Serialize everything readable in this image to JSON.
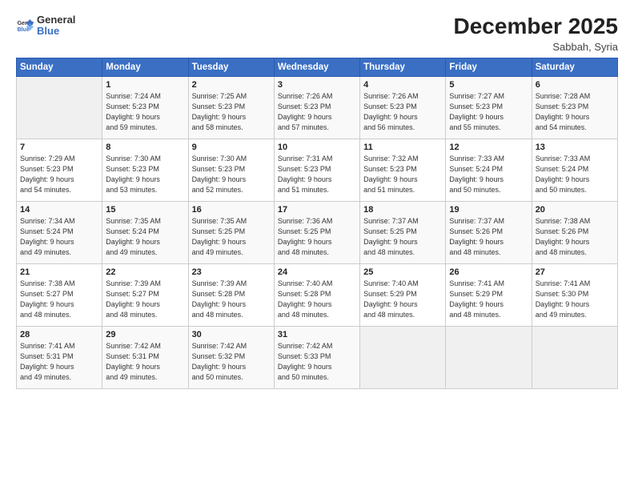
{
  "logo": {
    "general": "General",
    "blue": "Blue"
  },
  "title": "December 2025",
  "subtitle": "Sabbah, Syria",
  "days_header": [
    "Sunday",
    "Monday",
    "Tuesday",
    "Wednesday",
    "Thursday",
    "Friday",
    "Saturday"
  ],
  "weeks": [
    [
      {
        "day": "",
        "info": ""
      },
      {
        "day": "1",
        "info": "Sunrise: 7:24 AM\nSunset: 5:23 PM\nDaylight: 9 hours\nand 59 minutes."
      },
      {
        "day": "2",
        "info": "Sunrise: 7:25 AM\nSunset: 5:23 PM\nDaylight: 9 hours\nand 58 minutes."
      },
      {
        "day": "3",
        "info": "Sunrise: 7:26 AM\nSunset: 5:23 PM\nDaylight: 9 hours\nand 57 minutes."
      },
      {
        "day": "4",
        "info": "Sunrise: 7:26 AM\nSunset: 5:23 PM\nDaylight: 9 hours\nand 56 minutes."
      },
      {
        "day": "5",
        "info": "Sunrise: 7:27 AM\nSunset: 5:23 PM\nDaylight: 9 hours\nand 55 minutes."
      },
      {
        "day": "6",
        "info": "Sunrise: 7:28 AM\nSunset: 5:23 PM\nDaylight: 9 hours\nand 54 minutes."
      }
    ],
    [
      {
        "day": "7",
        "info": "Sunrise: 7:29 AM\nSunset: 5:23 PM\nDaylight: 9 hours\nand 54 minutes."
      },
      {
        "day": "8",
        "info": "Sunrise: 7:30 AM\nSunset: 5:23 PM\nDaylight: 9 hours\nand 53 minutes."
      },
      {
        "day": "9",
        "info": "Sunrise: 7:30 AM\nSunset: 5:23 PM\nDaylight: 9 hours\nand 52 minutes."
      },
      {
        "day": "10",
        "info": "Sunrise: 7:31 AM\nSunset: 5:23 PM\nDaylight: 9 hours\nand 51 minutes."
      },
      {
        "day": "11",
        "info": "Sunrise: 7:32 AM\nSunset: 5:23 PM\nDaylight: 9 hours\nand 51 minutes."
      },
      {
        "day": "12",
        "info": "Sunrise: 7:33 AM\nSunset: 5:24 PM\nDaylight: 9 hours\nand 50 minutes."
      },
      {
        "day": "13",
        "info": "Sunrise: 7:33 AM\nSunset: 5:24 PM\nDaylight: 9 hours\nand 50 minutes."
      }
    ],
    [
      {
        "day": "14",
        "info": "Sunrise: 7:34 AM\nSunset: 5:24 PM\nDaylight: 9 hours\nand 49 minutes."
      },
      {
        "day": "15",
        "info": "Sunrise: 7:35 AM\nSunset: 5:24 PM\nDaylight: 9 hours\nand 49 minutes."
      },
      {
        "day": "16",
        "info": "Sunrise: 7:35 AM\nSunset: 5:25 PM\nDaylight: 9 hours\nand 49 minutes."
      },
      {
        "day": "17",
        "info": "Sunrise: 7:36 AM\nSunset: 5:25 PM\nDaylight: 9 hours\nand 48 minutes."
      },
      {
        "day": "18",
        "info": "Sunrise: 7:37 AM\nSunset: 5:25 PM\nDaylight: 9 hours\nand 48 minutes."
      },
      {
        "day": "19",
        "info": "Sunrise: 7:37 AM\nSunset: 5:26 PM\nDaylight: 9 hours\nand 48 minutes."
      },
      {
        "day": "20",
        "info": "Sunrise: 7:38 AM\nSunset: 5:26 PM\nDaylight: 9 hours\nand 48 minutes."
      }
    ],
    [
      {
        "day": "21",
        "info": "Sunrise: 7:38 AM\nSunset: 5:27 PM\nDaylight: 9 hours\nand 48 minutes."
      },
      {
        "day": "22",
        "info": "Sunrise: 7:39 AM\nSunset: 5:27 PM\nDaylight: 9 hours\nand 48 minutes."
      },
      {
        "day": "23",
        "info": "Sunrise: 7:39 AM\nSunset: 5:28 PM\nDaylight: 9 hours\nand 48 minutes."
      },
      {
        "day": "24",
        "info": "Sunrise: 7:40 AM\nSunset: 5:28 PM\nDaylight: 9 hours\nand 48 minutes."
      },
      {
        "day": "25",
        "info": "Sunrise: 7:40 AM\nSunset: 5:29 PM\nDaylight: 9 hours\nand 48 minutes."
      },
      {
        "day": "26",
        "info": "Sunrise: 7:41 AM\nSunset: 5:29 PM\nDaylight: 9 hours\nand 48 minutes."
      },
      {
        "day": "27",
        "info": "Sunrise: 7:41 AM\nSunset: 5:30 PM\nDaylight: 9 hours\nand 49 minutes."
      }
    ],
    [
      {
        "day": "28",
        "info": "Sunrise: 7:41 AM\nSunset: 5:31 PM\nDaylight: 9 hours\nand 49 minutes."
      },
      {
        "day": "29",
        "info": "Sunrise: 7:42 AM\nSunset: 5:31 PM\nDaylight: 9 hours\nand 49 minutes."
      },
      {
        "day": "30",
        "info": "Sunrise: 7:42 AM\nSunset: 5:32 PM\nDaylight: 9 hours\nand 50 minutes."
      },
      {
        "day": "31",
        "info": "Sunrise: 7:42 AM\nSunset: 5:33 PM\nDaylight: 9 hours\nand 50 minutes."
      },
      {
        "day": "",
        "info": ""
      },
      {
        "day": "",
        "info": ""
      },
      {
        "day": "",
        "info": ""
      }
    ]
  ]
}
